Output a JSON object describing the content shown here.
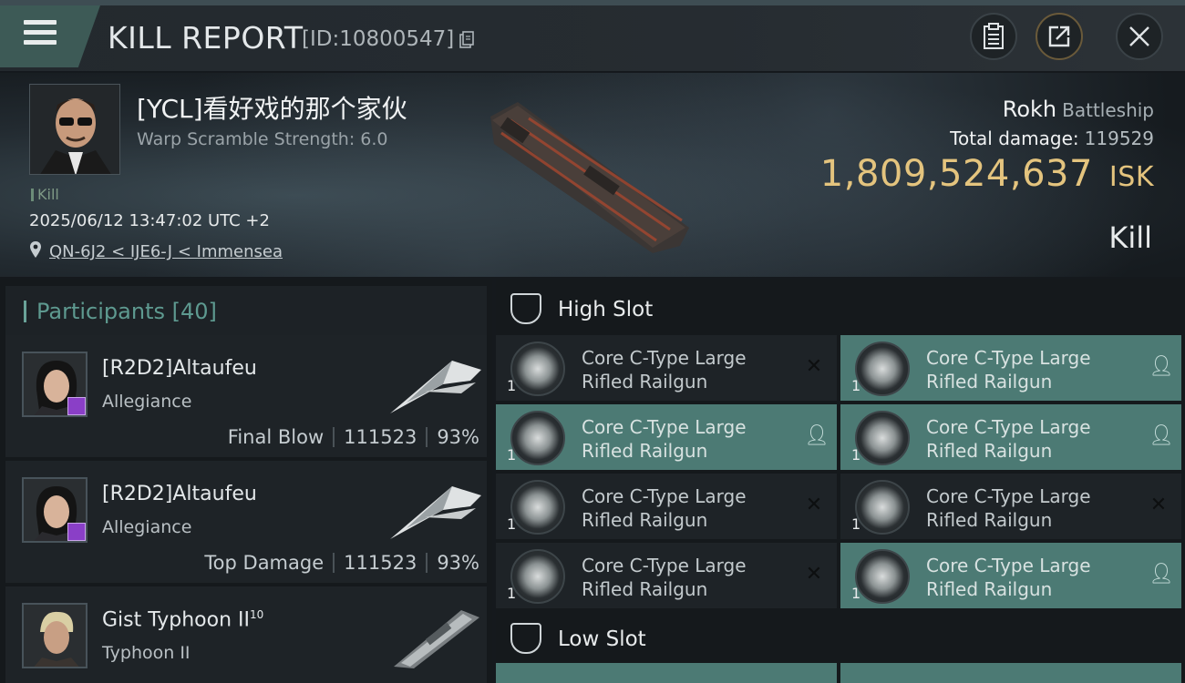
{
  "header": {
    "title": "KILL REPORT",
    "report_id": "[ID:10800547]",
    "icons": [
      "menu-icon",
      "copy-icon",
      "clipboard-icon",
      "share-icon",
      "close-icon"
    ]
  },
  "victim": {
    "name": "[YCL]看好戏的那个家伙",
    "warp": "Warp Scramble Strength: 6.0",
    "tag": "Kill",
    "date": "2025/06/12 13:47:02 UTC +2",
    "location": "QN-6J2 < IJE6-J < Immensea",
    "ship_name": "Rokh",
    "ship_class": "Battleship",
    "total_damage_label": "Total damage:",
    "total_damage": "119529",
    "isk_value": "1,809,524,637",
    "isk_unit": "ISK",
    "result": "Kill"
  },
  "participants": {
    "label": "Participants",
    "count": "[40]",
    "rows": [
      {
        "name": "[R2D2]Altaufeu",
        "corp": "Allegiance",
        "role": "Final Blow",
        "damage": "111523",
        "percent": "93%"
      },
      {
        "name": "[R2D2]Altaufeu",
        "corp": "Allegiance",
        "role": "Top Damage",
        "damage": "111523",
        "percent": "93%"
      },
      {
        "name": "Gist Typhoon II",
        "sup": "10",
        "corp": "Typhoon II"
      }
    ]
  },
  "slots": {
    "high": {
      "label": "High Slot",
      "items": [
        {
          "line1": "Core C-Type Large",
          "line2": "Rifled Railgun",
          "qty": "1",
          "state": "destroyed"
        },
        {
          "line1": "Core C-Type Large",
          "line2": "Rifled Railgun",
          "qty": "1",
          "state": "dropped"
        },
        {
          "line1": "Core C-Type Large",
          "line2": "Rifled Railgun",
          "qty": "1",
          "state": "dropped"
        },
        {
          "line1": "Core C-Type Large",
          "line2": "Rifled Railgun",
          "qty": "1",
          "state": "dropped"
        },
        {
          "line1": "Core C-Type Large",
          "line2": "Rifled Railgun",
          "qty": "1",
          "state": "destroyed"
        },
        {
          "line1": "Core C-Type Large",
          "line2": "Rifled Railgun",
          "qty": "1",
          "state": "destroyed"
        },
        {
          "line1": "Core C-Type Large",
          "line2": "Rifled Railgun",
          "qty": "1",
          "state": "destroyed"
        },
        {
          "line1": "Core C-Type Large",
          "line2": "Rifled Railgun",
          "qty": "1",
          "state": "dropped"
        }
      ]
    },
    "low": {
      "label": "Low Slot"
    }
  }
}
